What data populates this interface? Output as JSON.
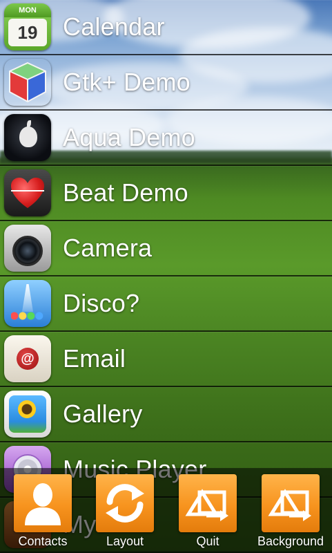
{
  "apps": [
    {
      "label": "Calendar",
      "icon": "calendar-icon",
      "icon_text": {
        "day": "MON",
        "date": "19"
      }
    },
    {
      "label": "Gtk+ Demo",
      "icon": "gtk-cube-icon"
    },
    {
      "label": "Aqua Demo",
      "icon": "apple-logo-icon"
    },
    {
      "label": "Beat Demo",
      "icon": "heart-pulse-icon"
    },
    {
      "label": "Camera",
      "icon": "camera-icon"
    },
    {
      "label": "Disco?",
      "icon": "disco-lights-icon"
    },
    {
      "label": "Email",
      "icon": "email-seal-icon",
      "icon_text": {
        "glyph": "@"
      }
    },
    {
      "label": "Gallery",
      "icon": "gallery-sunflower-icon"
    },
    {
      "label": "Music Player",
      "icon": "music-disc-icon"
    },
    {
      "label": "My",
      "icon": "my-app-icon"
    }
  ],
  "dock": [
    {
      "label": "Contacts",
      "icon": "contacts-person-icon"
    },
    {
      "label": "Layout",
      "icon": "layout-refresh-icon"
    },
    {
      "label": "Quit",
      "icon": "quit-swap-icon"
    },
    {
      "label": "Background",
      "icon": "background-swap-icon"
    }
  ],
  "colors": {
    "dock_accent": "#f7931e",
    "label_text": "#ffffff",
    "row_divider": "#000000"
  }
}
